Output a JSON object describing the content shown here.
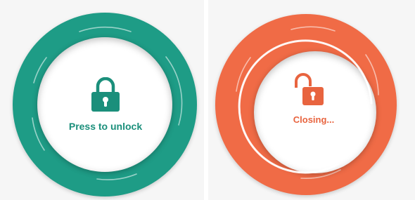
{
  "left_panel": {
    "label": "Press to unlock",
    "state": "locked",
    "icon": "lock-closed-icon",
    "ring_color": "#1e9c86",
    "accent_color": "#1b8f7b"
  },
  "right_panel": {
    "label": "Closing...",
    "state": "closing",
    "icon": "lock-open-icon",
    "ring_color": "#f06b46",
    "accent_color": "#e8643f"
  }
}
